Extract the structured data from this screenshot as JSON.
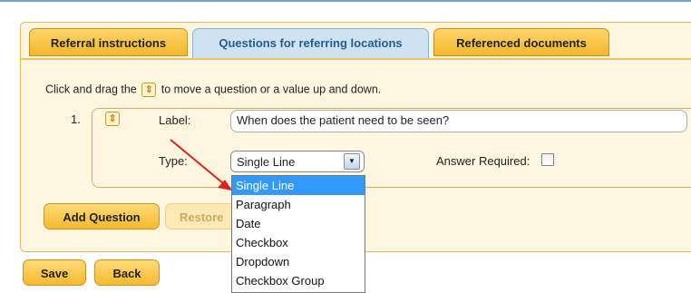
{
  "tabs": [
    {
      "label": "Referral instructions",
      "active": false
    },
    {
      "label": "Questions for referring locations",
      "active": true
    },
    {
      "label": "Referenced documents",
      "active": false
    }
  ],
  "instruction": {
    "before": "Click and drag the",
    "after": "to move a question or a value up and down."
  },
  "question": {
    "number": "1.",
    "label_caption": "Label:",
    "label_value": "When does the patient need to be seen?",
    "type_caption": "Type:",
    "type_value": "Single Line",
    "answer_required_caption": "Answer Required:",
    "answer_required_checked": false
  },
  "dropdown": {
    "options": [
      "Single Line",
      "Paragraph",
      "Date",
      "Checkbox",
      "Dropdown",
      "Checkbox Group"
    ],
    "selected_index": 0
  },
  "buttons": {
    "add_question": "Add Question",
    "restore": "Restore",
    "save": "Save",
    "back": "Back"
  },
  "colors": {
    "accent": "#f4b92e",
    "active_tab": "#cfe2f2",
    "panel": "#fff6df",
    "annotation_arrow": "#e02020",
    "highlight": "#3399ff"
  },
  "icons": {
    "drag_handle": "up-down-drag-icon",
    "select_toggle": "chevron-down-icon",
    "annotation": "red-arrow"
  }
}
